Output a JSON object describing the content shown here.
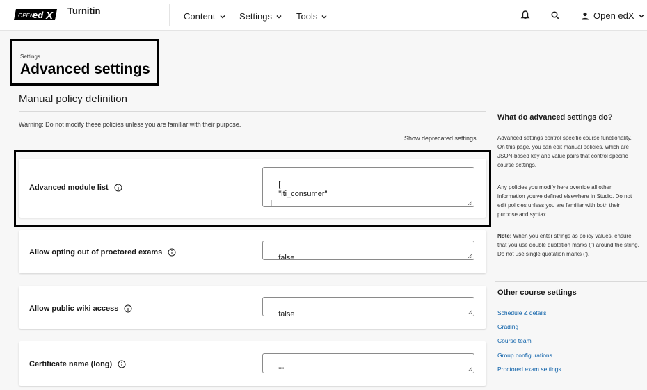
{
  "header": {
    "logo_text": "OPEN edX",
    "course_title": "Turnitin",
    "nav": [
      {
        "label": "Content"
      },
      {
        "label": "Settings"
      },
      {
        "label": "Tools"
      }
    ],
    "user_label": "Open edX"
  },
  "page": {
    "breadcrumb": "Settings",
    "title": "Advanced settings",
    "section_heading": "Manual policy definition",
    "warning": "Warning: Do not modify these policies unless you are familiar with their purpose.",
    "show_deprecated": "Show deprecated settings"
  },
  "settings": [
    {
      "label": "Advanced module list",
      "value": "[\n    \"lti_consumer\"\n]"
    },
    {
      "label": "Allow opting out of proctored exams",
      "value": "false"
    },
    {
      "label": "Allow public wiki access",
      "value": "false"
    },
    {
      "label": "Certificate name (long)",
      "value": "\"\""
    }
  ],
  "sidebar": {
    "heading1": "What do advanced settings do?",
    "para1": "Advanced settings control specific course functionality. On this page, you can edit manual policies, which are JSON-based key and value pairs that control specific course settings.",
    "para2": "Any policies you modify here override all other information you've defined elsewhere in Studio. Do not edit policies unless you are familiar with both their purpose and syntax.",
    "note_label": "Note:",
    "note_text": " When you enter strings as policy values, ensure that you use double quotation marks (\") around the string. Do not use single quotation marks (').",
    "heading2": "Other course settings",
    "links": [
      {
        "label": "Schedule & details"
      },
      {
        "label": "Grading"
      },
      {
        "label": "Course team"
      },
      {
        "label": "Group configurations"
      },
      {
        "label": "Proctored exam settings"
      }
    ]
  },
  "colors": {
    "accent_link": "#0a5fa8",
    "highlight_border": "#000000"
  }
}
